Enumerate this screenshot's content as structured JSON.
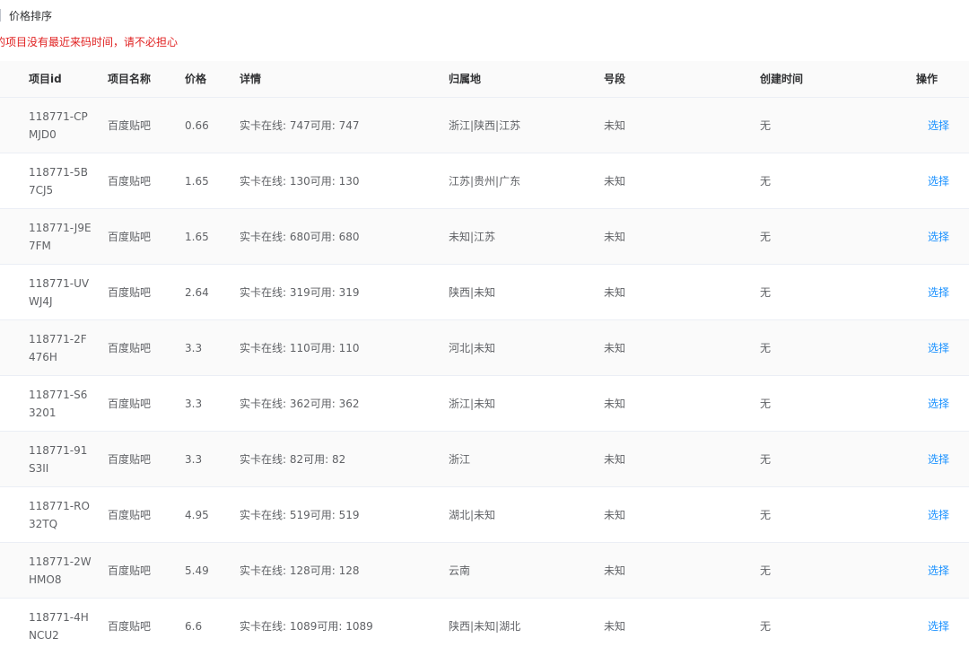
{
  "tab": {
    "label": "价格排序"
  },
  "notice": {
    "text": "的项目没有最近来码时间，请不必担心"
  },
  "table": {
    "headers": {
      "id": "项目id",
      "name": "项目名称",
      "price": "价格",
      "detail": "详情",
      "region": "归属地",
      "segment": "号段",
      "created": "创建时间",
      "action": "操作"
    },
    "rows": [
      {
        "id": "118771-CPMJD0",
        "name": "百度贴吧",
        "price": "0.66",
        "detail": "实卡在线: 747可用: 747",
        "region": "浙江|陕西|江苏",
        "segment": "未知",
        "created": "无",
        "action": "选择"
      },
      {
        "id": "118771-5B7CJ5",
        "name": "百度贴吧",
        "price": "1.65",
        "detail": "实卡在线: 130可用: 130",
        "region": "江苏|贵州|广东",
        "segment": "未知",
        "created": "无",
        "action": "选择"
      },
      {
        "id": "118771-J9E7FM",
        "name": "百度贴吧",
        "price": "1.65",
        "detail": "实卡在线: 680可用: 680",
        "region": "未知|江苏",
        "segment": "未知",
        "created": "无",
        "action": "选择"
      },
      {
        "id": "118771-UVWJ4J",
        "name": "百度贴吧",
        "price": "2.64",
        "detail": "实卡在线: 319可用: 319",
        "region": "陕西|未知",
        "segment": "未知",
        "created": "无",
        "action": "选择"
      },
      {
        "id": "118771-2F476H",
        "name": "百度贴吧",
        "price": "3.3",
        "detail": "实卡在线: 110可用: 110",
        "region": "河北|未知",
        "segment": "未知",
        "created": "无",
        "action": "选择"
      },
      {
        "id": "118771-S63201",
        "name": "百度贴吧",
        "price": "3.3",
        "detail": "实卡在线: 362可用: 362",
        "region": "浙江|未知",
        "segment": "未知",
        "created": "无",
        "action": "选择"
      },
      {
        "id": "118771-91S3II",
        "name": "百度贴吧",
        "price": "3.3",
        "detail": "实卡在线: 82可用: 82",
        "region": "浙江",
        "segment": "未知",
        "created": "无",
        "action": "选择"
      },
      {
        "id": "118771-RO32TQ",
        "name": "百度贴吧",
        "price": "4.95",
        "detail": "实卡在线: 519可用: 519",
        "region": "湖北|未知",
        "segment": "未知",
        "created": "无",
        "action": "选择"
      },
      {
        "id": "118771-2WHMO8",
        "name": "百度贴吧",
        "price": "5.49",
        "detail": "实卡在线: 128可用: 128",
        "region": "云南",
        "segment": "未知",
        "created": "无",
        "action": "选择"
      },
      {
        "id": "118771-4HNCU2",
        "name": "百度贴吧",
        "price": "6.6",
        "detail": "实卡在线: 1089可用: 1089",
        "region": "陕西|未知|湖北",
        "segment": "未知",
        "created": "无",
        "action": "选择"
      }
    ]
  }
}
